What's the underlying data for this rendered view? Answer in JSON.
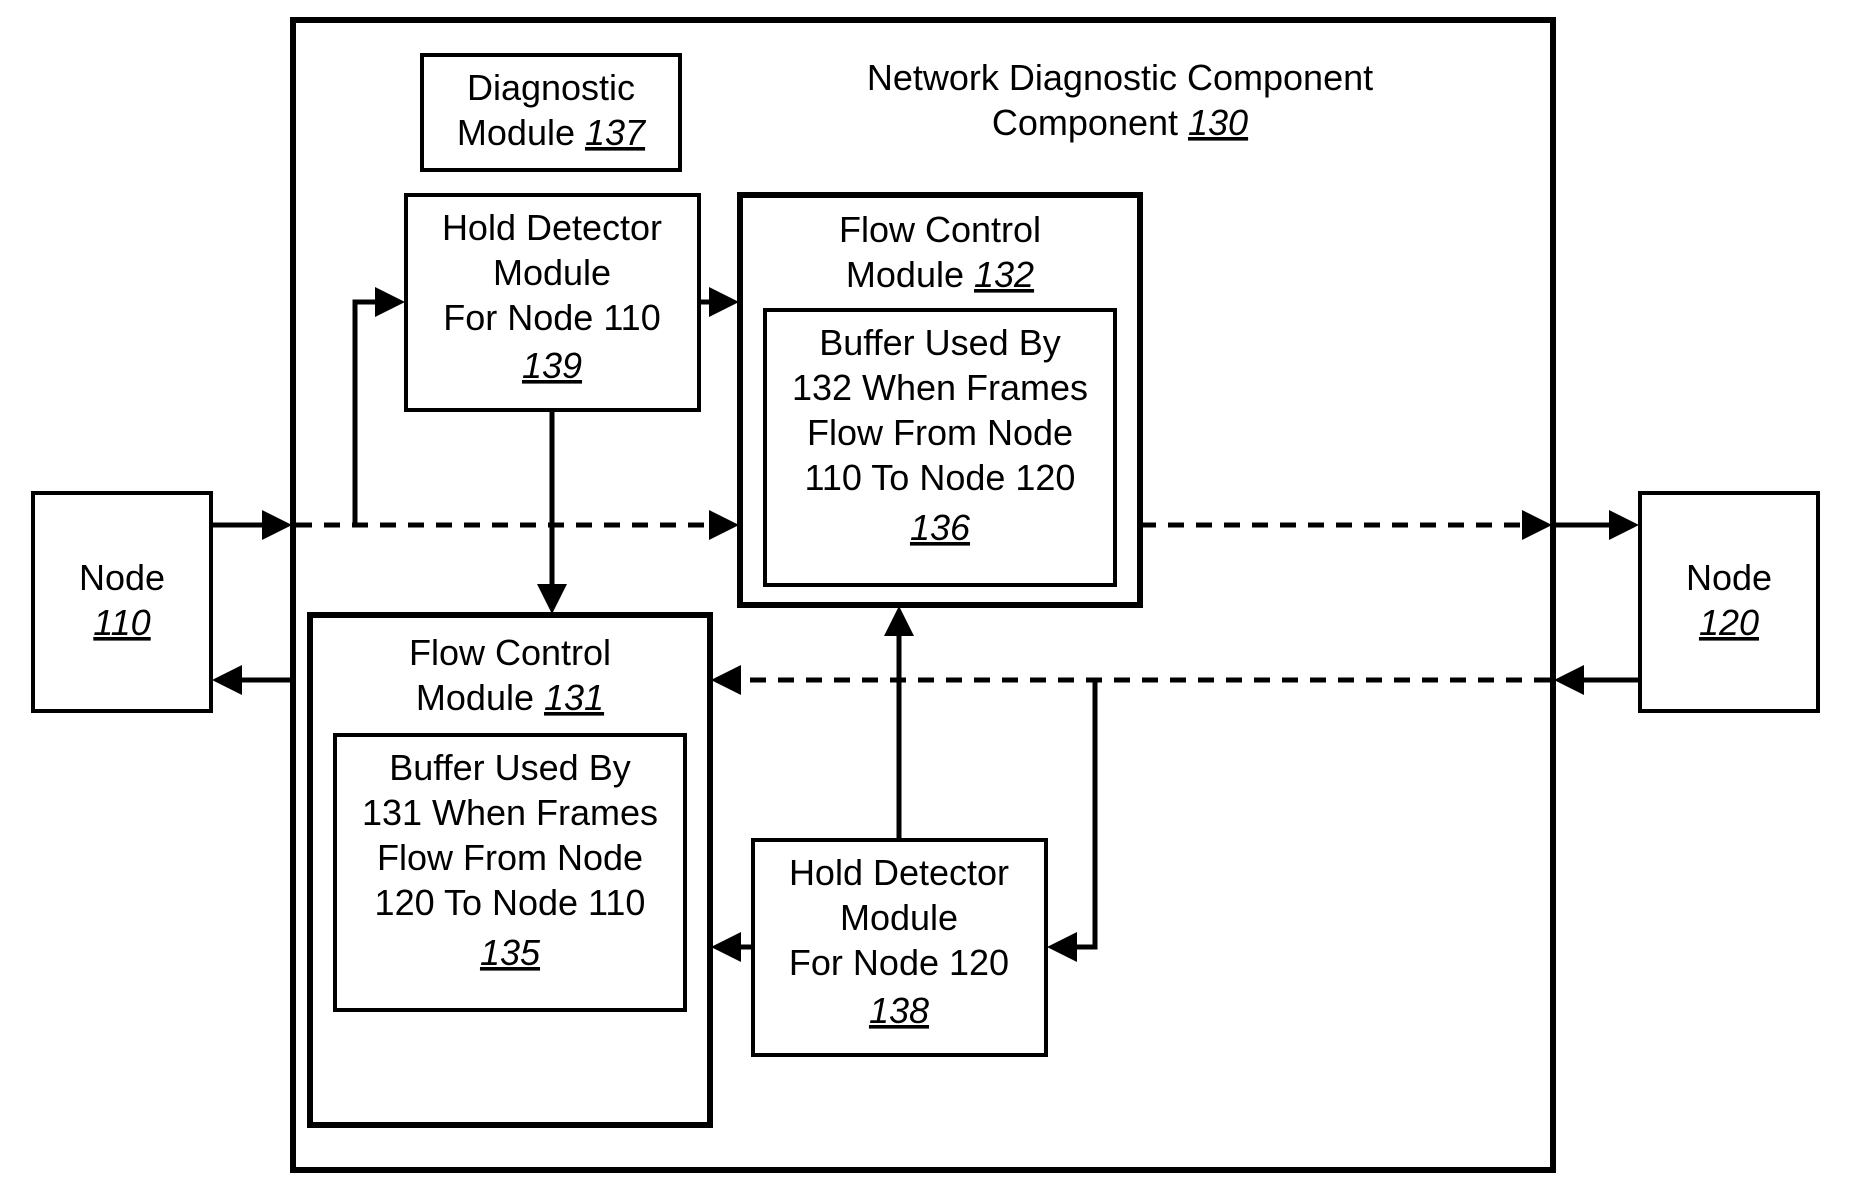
{
  "node110": {
    "label": "Node",
    "num": "110"
  },
  "node120": {
    "label": "Node",
    "num": "120"
  },
  "ndc": {
    "label": "Network Diagnostic Component",
    "num": "130"
  },
  "diag": {
    "label1": "Diagnostic",
    "label2": "Module",
    "num": "137"
  },
  "hold110": {
    "label1": "Hold Detector",
    "label2": "Module",
    "label3": "For Node 110",
    "num": "139"
  },
  "hold120": {
    "label1": "Hold Detector",
    "label2": "Module",
    "label3": "For Node 120",
    "num": "138"
  },
  "fc132": {
    "label1": "Flow Control",
    "label2": "Module",
    "num": "132"
  },
  "fc131": {
    "label1": "Flow Control",
    "label2": "Module",
    "num": "131"
  },
  "buf136": {
    "l1": "Buffer Used By",
    "l2": "132 When Frames",
    "l3": "Flow From Node",
    "l4": "110 To Node 120",
    "num": "136"
  },
  "buf135": {
    "l1": "Buffer Used By",
    "l2": "131 When Frames",
    "l3": "Flow From Node",
    "l4": "120 To Node 110",
    "num": "135"
  }
}
